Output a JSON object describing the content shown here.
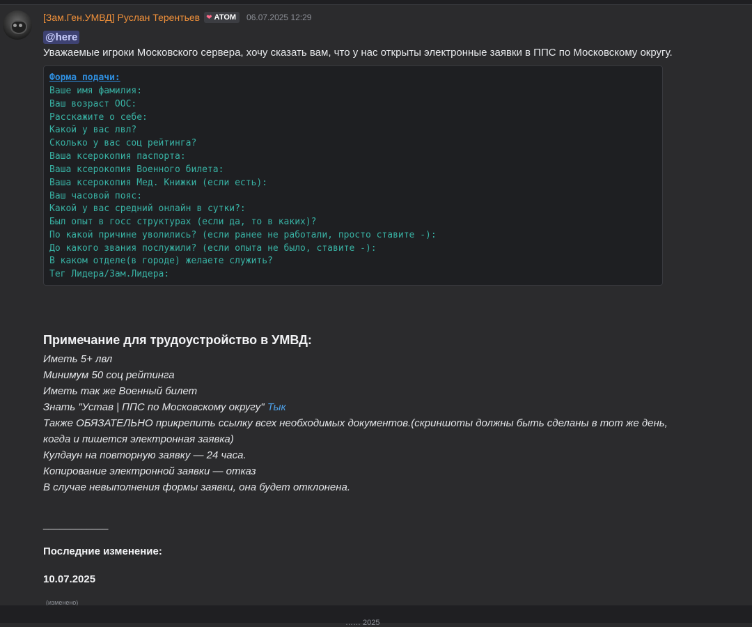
{
  "message": {
    "author": "[Зам.Ген.УМВД] Руслан Терентьев",
    "tag": "АТОМ",
    "timestamp": "06.07.2025 12:29",
    "mention": "@here",
    "intro": "Уважаемые игроки Московского сервера, хочу сказать вам, что у нас открыты электронные заявки в ППС по Московскому округу.",
    "form_lines": [
      "Форма подачи:",
      "Ваше имя фамилия:",
      "Ваш возраст ООС:",
      "Расскажите о себе:",
      "Какой у вас лвл?",
      "Сколько у вас соц рейтинга?",
      "Ваша ксерокопия паспорта:",
      "Ваша ксерокопия Военного билета:",
      "Ваша ксерокопия Мед. Книжки (если есть):",
      "Ваш часовой пояс:",
      "Какой у вас средний онлайн в сутки?:",
      "Был опыт в госс структурах (если да, то в каких)?",
      "По какой причине уволились? (если ранее не работали, просто ставите -):",
      "До какого звания послужили? (если опыта не было, ставите -):",
      "В каком отделе(в городе) желаете служить?",
      "Тег Лидера/Зам.Лидера:"
    ],
    "note_heading": "Примечание для трудоустройство в УМВД:",
    "requirements": [
      "Иметь 5+ лвл",
      "Минимум 50 соц рейтинга",
      "Иметь так же Военный билет",
      "Знать \"Устав | ППС по Московскому округу\"",
      "Также ОБЯЗАТЕЛЬНО прикрепить ссылку  всех необходимых документов.(скриншоты должны быть сделаны в тот же день,",
      "когда и пишется электронная заявка)",
      "Кулдаун на повторную заявку — 24 часа.",
      "Копирование электронной заявки — отказ",
      "В случае невыполнения формы заявки, она будет отклонена."
    ],
    "link_text": "Тык",
    "divider": "____________",
    "changes_title": "Последние изменение:",
    "changes_date": "10.07.2025",
    "edited": "(изменено)"
  },
  "footer": {
    "partial_text": "…… 2025"
  },
  "colors": {
    "username": "#f0903a",
    "code_text": "#38b2a4",
    "code_title": "#2f8fe0",
    "link": "#4d9fe6",
    "mention_bg": "#3e4272"
  }
}
